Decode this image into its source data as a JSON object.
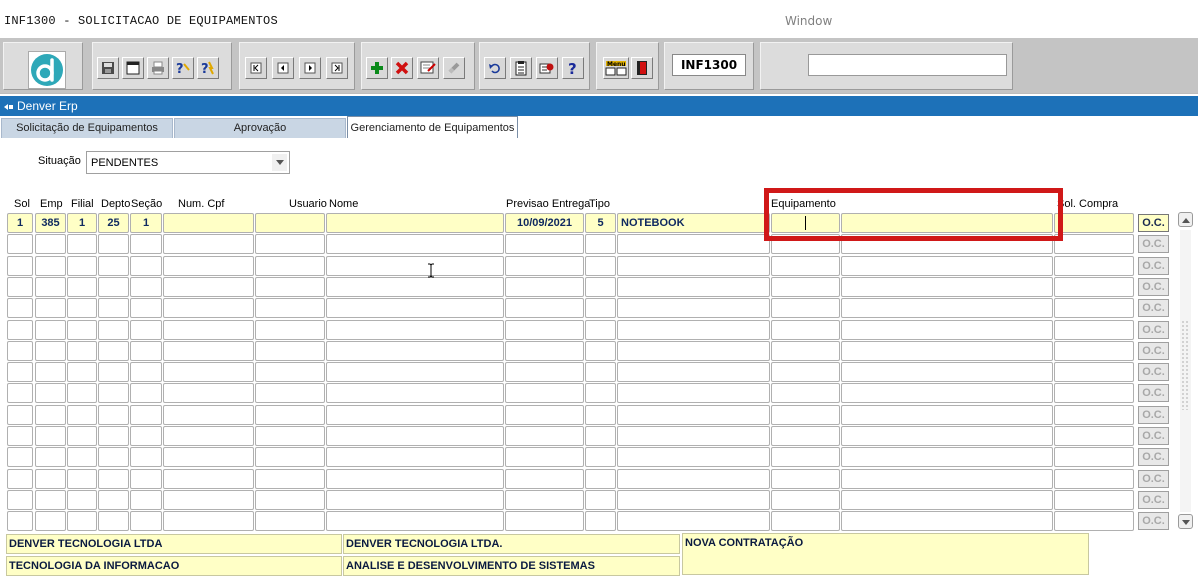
{
  "menubar": {
    "form_title": "INF1300 - SOLICITACAO DE EQUIPAMENTOS",
    "window_menu": "Window"
  },
  "toolbar": {
    "form_code": "INF1300",
    "search_value": "",
    "icons": [
      "logo-icon",
      "save-icon",
      "window-icon",
      "print-icon",
      "query-icon",
      "execute-query-icon",
      "first-record-icon",
      "previous-record-icon",
      "next-record-icon",
      "last-record-icon",
      "insert-record-icon",
      "delete-record-icon",
      "edit-icon",
      "clear-icon",
      "undo-icon",
      "list-icon",
      "config-icon",
      "help-icon",
      "menu-icon",
      "exit-icon"
    ]
  },
  "window": {
    "title": "Denver Erp"
  },
  "tabs": [
    {
      "label": "Solicitação de Equipamentos",
      "active": false
    },
    {
      "label": "Aprovação",
      "active": false
    },
    {
      "label": "Gerenciamento de Equipamentos",
      "active": true
    }
  ],
  "filter": {
    "label": "Situação",
    "value": "PENDENTES"
  },
  "columns": {
    "sol": "Sol",
    "emp": "Emp",
    "filial": "Filial",
    "depto": "Depto",
    "secao": "Seção",
    "cpf": "Num. Cpf",
    "usuario": "Usuario",
    "nome": "Nome",
    "previsao": "Previsao Entrega",
    "tipo": "Tipo",
    "equipamento": "Equipamento",
    "sol_compra": "Sol. Compra"
  },
  "rows": [
    {
      "sol": "1",
      "emp": "385",
      "filial": "1",
      "depto": "25",
      "secao": "1",
      "cpf": "",
      "usuario": "",
      "nome": "",
      "previsao": "10/09/2021",
      "tipo": "5",
      "tipo_desc": "NOTEBOOK",
      "equip_code": "",
      "equip_desc": "",
      "sol_compra": ""
    }
  ],
  "oc_label": "O.C.",
  "visible_rows": 15,
  "footer": {
    "empresa": "DENVER TECNOLOGIA LTDA",
    "filial": "DENVER TECNOLOGIA LTDA.",
    "motivo": "NOVA CONTRATAÇÃO",
    "depto": "TECNOLOGIA DA INFORMACAO",
    "secao": "ANALISE E DESENVOLVIMENTO DE SISTEMAS"
  },
  "colors": {
    "title_bar": "#1d71b8",
    "field_yellow": "#ffffc6",
    "highlight_red": "#d01818",
    "toolbar_gray": "#c4c4c4"
  }
}
